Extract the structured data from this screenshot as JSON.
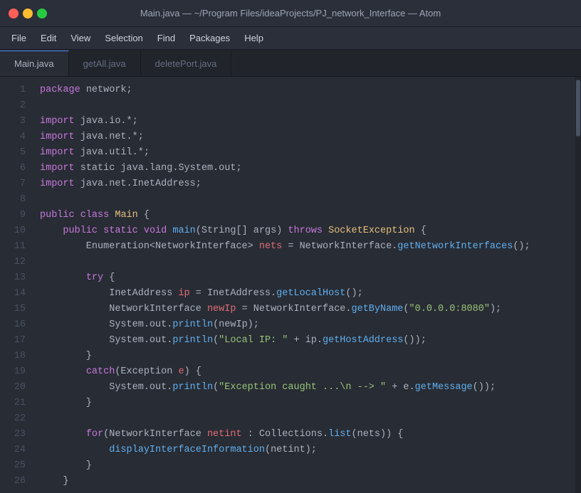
{
  "titlebar": {
    "title": "Main.java — ~/Program Files/ideaProjects/PJ_network_Interface — Atom"
  },
  "menubar": {
    "items": [
      "File",
      "Edit",
      "View",
      "Selection",
      "Find",
      "Packages",
      "Help"
    ]
  },
  "tabs": [
    {
      "label": "Main.java",
      "active": true
    },
    {
      "label": "getAll.java",
      "active": false
    },
    {
      "label": "deletePort.java",
      "active": false
    }
  ],
  "lines": [
    1,
    2,
    3,
    4,
    5,
    6,
    7,
    8,
    9,
    10,
    11,
    12,
    13,
    14,
    15,
    16,
    17,
    18,
    19,
    20,
    21,
    22,
    23,
    24,
    25,
    26
  ]
}
